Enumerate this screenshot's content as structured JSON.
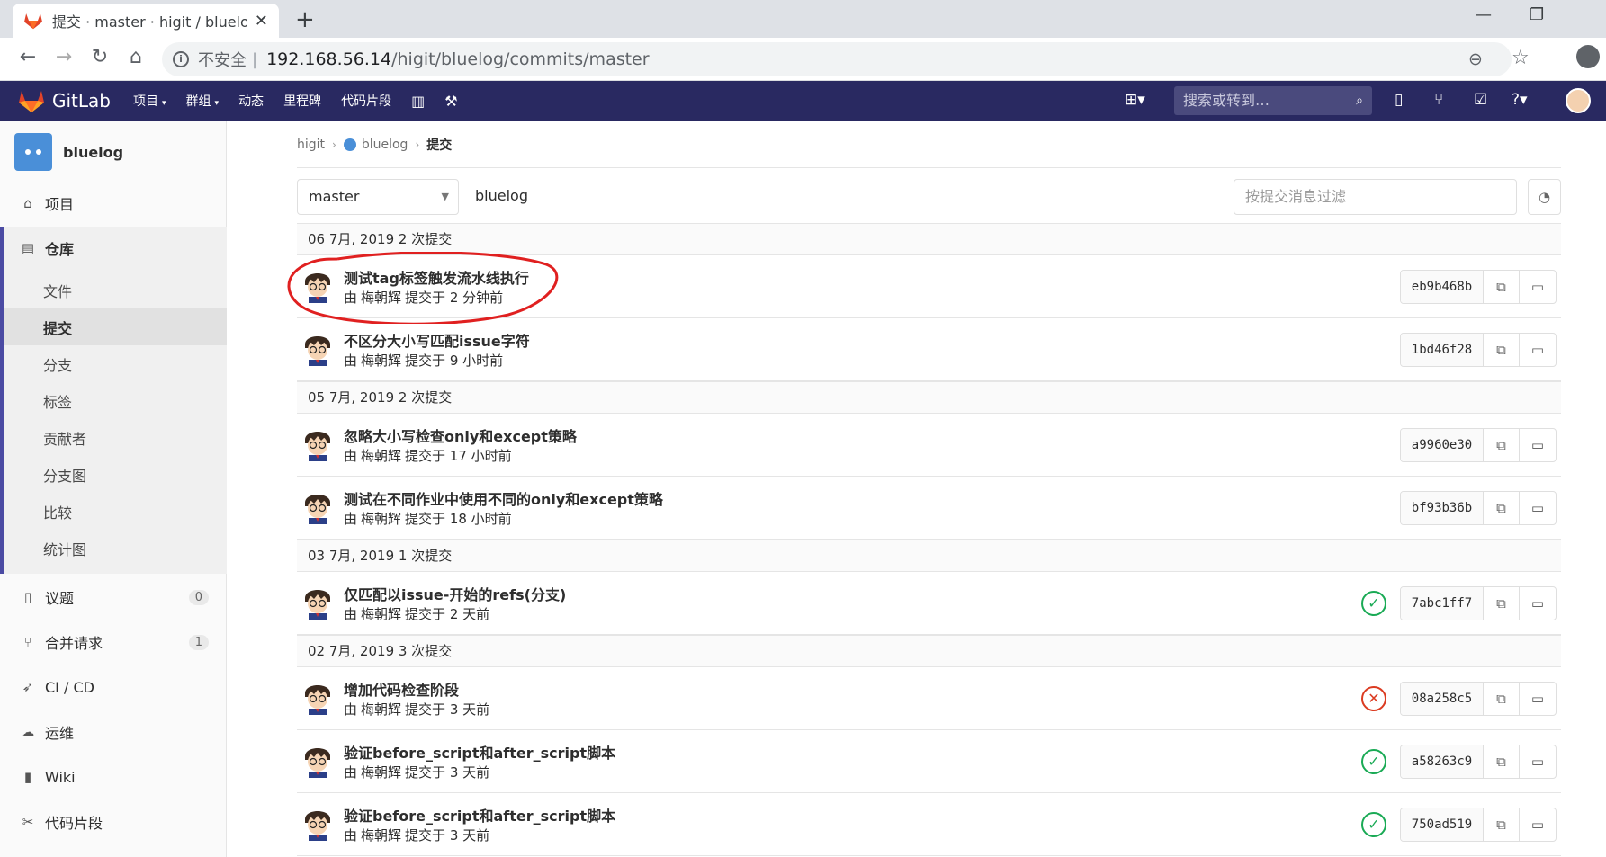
{
  "browser": {
    "tab_title": "提交 · master · higit / bluelog ·",
    "tab_close": "✕",
    "new_tab": "+",
    "address_insecure": "不安全",
    "address_sep": "|",
    "address_host": "192.168.56.14",
    "address_path": "/higit/bluelog/commits/master"
  },
  "gitlab": {
    "brand": "GitLab",
    "nav": [
      {
        "label": "项目",
        "caret": "▾"
      },
      {
        "label": "群组",
        "caret": "▾"
      },
      {
        "label": "动态"
      },
      {
        "label": "里程碑"
      },
      {
        "label": "代码片段"
      }
    ],
    "search_placeholder": "搜索或转到…",
    "accent": "#292961"
  },
  "sidebar": {
    "project_name": "bluelog",
    "items": [
      {
        "label": "项目",
        "icon": "home-icon"
      },
      {
        "label": "仓库",
        "icon": "book-icon"
      },
      {
        "label": "议题",
        "icon": "issues-icon",
        "badge": "0"
      },
      {
        "label": "合并请求",
        "icon": "merge-request-icon",
        "badge": "1"
      },
      {
        "label": "CI / CD",
        "icon": "rocket-icon"
      },
      {
        "label": "运维",
        "icon": "cloud-icon"
      },
      {
        "label": "Wiki",
        "icon": "book-icon"
      },
      {
        "label": "代码片段",
        "icon": "scissors-icon"
      }
    ],
    "repo_sub": [
      "文件",
      "提交",
      "分支",
      "标签",
      "贡献者",
      "分支图",
      "比较",
      "统计图"
    ]
  },
  "breadcrumb": {
    "group": "higit",
    "project": "bluelog",
    "current": "提交"
  },
  "toolbar": {
    "branch": "master",
    "path": "bluelog",
    "filter_placeholder": "按提交消息过滤"
  },
  "commits": {
    "author_prefix": "由",
    "author": "梅朝辉",
    "committed": "提交于",
    "days": [
      {
        "header": "06 7月, 2019 2 次提交",
        "items": [
          {
            "title": "测试tag标签触发流水线执行",
            "when": "2 分钟前",
            "sha": "eb9b468b",
            "status": ""
          },
          {
            "title": "不区分大小写匹配issue字符",
            "when": "9 小时前",
            "sha": "1bd46f28",
            "status": ""
          }
        ]
      },
      {
        "header": "05 7月, 2019 2 次提交",
        "items": [
          {
            "title": "忽略大小写检查only和except策略",
            "when": "17 小时前",
            "sha": "a9960e30",
            "status": ""
          },
          {
            "title": "测试在不同作业中使用不同的only和except策略",
            "when": "18 小时前",
            "sha": "bf93b36b",
            "status": ""
          }
        ]
      },
      {
        "header": "03 7月, 2019 1 次提交",
        "items": [
          {
            "title": "仅匹配以issue-开始的refs(分支)",
            "when": "2 天前",
            "sha": "7abc1ff7",
            "status": "passed"
          }
        ]
      },
      {
        "header": "02 7月, 2019 3 次提交",
        "items": [
          {
            "title": "增加代码检查阶段",
            "when": "3 天前",
            "sha": "08a258c5",
            "status": "failed"
          },
          {
            "title": "验证before_script和after_script脚本",
            "when": "3 天前",
            "sha": "a58263c9",
            "status": "passed"
          },
          {
            "title": "验证before_script和after_script脚本",
            "when": "3 天前",
            "sha": "750ad519",
            "status": "passed"
          }
        ]
      }
    ]
  },
  "colors": {
    "passed": "#1aaa55",
    "failed": "#db3b21",
    "annotation": "#e02020"
  }
}
